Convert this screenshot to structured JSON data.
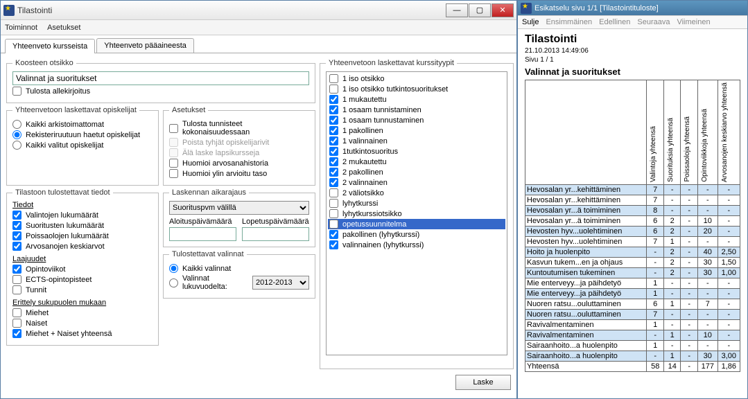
{
  "window": {
    "title": "Tilastointi"
  },
  "menu": {
    "items": [
      "Toiminnot",
      "Asetukset"
    ]
  },
  "tabs": [
    {
      "label": "Yhteenveto kursseista",
      "active": true
    },
    {
      "label": "Yhteenveto pääaineesta",
      "active": false
    }
  ],
  "group_koosteen": {
    "legend": "Koosteen otsikko",
    "value": "Valinnat ja suoritukset",
    "print_sign_label": "Tulosta allekirjoitus",
    "print_sign_checked": false
  },
  "group_laskettavat": {
    "legend": "Yhteenvetoon laskettavat opiskelijat",
    "options": [
      {
        "label": "Kaikki arkistoimattomat",
        "checked": false
      },
      {
        "label": "Rekisteriruutuun haetut opiskelijat",
        "checked": true
      },
      {
        "label": "Kaikki valitut opiskelijat",
        "checked": false
      }
    ]
  },
  "group_tulostettavat": {
    "legend": "Tilastoon tulostettavat tiedot",
    "heading_tiedot": "Tiedot",
    "tiedot": [
      {
        "label": "Valintojen lukumäärät",
        "checked": true
      },
      {
        "label": "Suoritusten lukumäärät",
        "checked": true
      },
      {
        "label": "Poissaolojen lukumäärät",
        "checked": true
      },
      {
        "label": "Arvosanojen keskiarvot",
        "checked": true
      }
    ],
    "heading_laajuudet": "Laajuudet",
    "laajuudet": [
      {
        "label": "Opintoviikot",
        "checked": true
      },
      {
        "label": "ECTS-opintopisteet",
        "checked": false
      },
      {
        "label": "Tunnit",
        "checked": false
      }
    ],
    "heading_erittely": "Erittely sukupuolen mukaan",
    "erittely": [
      {
        "label": "Miehet",
        "checked": false
      },
      {
        "label": "Naiset",
        "checked": false
      },
      {
        "label": "Miehet + Naiset yhteensä",
        "checked": true
      }
    ]
  },
  "group_asetukset": {
    "legend": "Asetukset",
    "items": [
      {
        "label": "Tulosta tunnisteet kokonaisuudessaan",
        "checked": false,
        "disabled": false
      },
      {
        "label": "Poista tyhjät opiskelijarivit",
        "checked": false,
        "disabled": true
      },
      {
        "label": "Älä laske lapsikursseja",
        "checked": false,
        "disabled": true
      },
      {
        "label": "Huomioi arvosanahistoria",
        "checked": false,
        "disabled": false
      },
      {
        "label": "Huomioi ylin arvioitu taso",
        "checked": false,
        "disabled": false
      }
    ]
  },
  "group_aikarajaus": {
    "legend": "Laskennan aikarajaus",
    "select_label": "Suorituspvm välillä",
    "start_label": "Aloituspäivämäärä",
    "end_label": "Lopetuspäivämäärä"
  },
  "group_valinnat": {
    "legend": "Tulostettavat valinnat",
    "options": [
      {
        "label": "Kaikki valinnat",
        "checked": true
      },
      {
        "label": "Valinnat lukuvuodelta:",
        "checked": false
      }
    ],
    "year": "2012-2013"
  },
  "group_kurssityypit": {
    "legend": "Yhteenvetoon laskettavat kurssityypit",
    "items": [
      {
        "label": "1 iso otsikko",
        "checked": false,
        "selected": false
      },
      {
        "label": "1 iso otsikko tutkintosuoritukset",
        "checked": false,
        "selected": false
      },
      {
        "label": "1 mukautettu",
        "checked": true,
        "selected": false
      },
      {
        "label": "1 osaam tunnistaminen",
        "checked": true,
        "selected": false
      },
      {
        "label": "1 osaam tunnustaminen",
        "checked": true,
        "selected": false
      },
      {
        "label": "1 pakollinen",
        "checked": true,
        "selected": false
      },
      {
        "label": "1 valinnainen",
        "checked": true,
        "selected": false
      },
      {
        "label": "1tutkintosuoritus",
        "checked": true,
        "selected": false
      },
      {
        "label": "2 mukautettu",
        "checked": true,
        "selected": false
      },
      {
        "label": "2 pakollinen",
        "checked": true,
        "selected": false
      },
      {
        "label": "2 valinnainen",
        "checked": true,
        "selected": false
      },
      {
        "label": "2 väliotsikko",
        "checked": false,
        "selected": false
      },
      {
        "label": "lyhytkurssi",
        "checked": false,
        "selected": false
      },
      {
        "label": "lyhytkurssiotsikko",
        "checked": false,
        "selected": false
      },
      {
        "label": "opetussuunnitelma",
        "checked": false,
        "selected": true
      },
      {
        "label": "pakollinen (lyhytkurssi)",
        "checked": true,
        "selected": false
      },
      {
        "label": "valinnainen (lyhytkurssi)",
        "checked": true,
        "selected": false
      }
    ]
  },
  "laske_button": "Laske",
  "preview": {
    "title": "Esikatselu sivu 1/1 [Tilastointituloste]",
    "nav": [
      "Sulje",
      "Ensimmäinen",
      "Edellinen",
      "Seuraava",
      "Viimeinen"
    ],
    "report_title": "Tilastointi",
    "timestamp": "21.10.2013 14:49:06",
    "page_line": "Sivu 1 / 1",
    "subtitle": "Valinnat ja suoritukset",
    "columns": [
      "",
      "Valintoja yhteensä",
      "Suorituksia yhteensä",
      "Poissaoloja yhteensä",
      "Opintoviikkoja yhteensä",
      "Arvosanojen keskiarvo yhteensä"
    ],
    "rows": [
      {
        "alt": true,
        "c": [
          "Hevosalan yr...kehittäminen",
          "7",
          "-",
          "-",
          "-",
          "-"
        ]
      },
      {
        "alt": false,
        "c": [
          "Hevosalan yr...kehittäminen",
          "7",
          "-",
          "-",
          "-",
          "-"
        ]
      },
      {
        "alt": true,
        "c": [
          "Hevosalan yr...ä toimiminen",
          "8",
          "-",
          "-",
          "-",
          "-"
        ]
      },
      {
        "alt": false,
        "c": [
          "Hevosalan yr...ä toimiminen",
          "6",
          "2",
          "-",
          "10",
          "-"
        ]
      },
      {
        "alt": true,
        "c": [
          "Hevosten hyv...uolehtiminen",
          "6",
          "2",
          "-",
          "20",
          "-"
        ]
      },
      {
        "alt": false,
        "c": [
          "Hevosten hyv...uolehtiminen",
          "7",
          "1",
          "-",
          "-",
          "-"
        ]
      },
      {
        "alt": true,
        "c": [
          "Hoito ja huolenpito",
          "-",
          "2",
          "-",
          "40",
          "2,50"
        ]
      },
      {
        "alt": false,
        "c": [
          "Kasvun tukem...en ja ohjaus",
          "-",
          "2",
          "-",
          "30",
          "1,50"
        ]
      },
      {
        "alt": true,
        "c": [
          "Kuntoutumisen tukeminen",
          "-",
          "2",
          "-",
          "30",
          "1,00"
        ]
      },
      {
        "alt": false,
        "c": [
          "Mie enterveyy...ja päihdetyö",
          "1",
          "-",
          "-",
          "-",
          "-"
        ]
      },
      {
        "alt": true,
        "c": [
          "Mie enterveyy...ja päihdetyö",
          "1",
          "-",
          "-",
          "-",
          "-"
        ]
      },
      {
        "alt": false,
        "c": [
          "Nuoren ratsu...ouluttaminen",
          "6",
          "1",
          "-",
          "7",
          "-"
        ]
      },
      {
        "alt": true,
        "c": [
          "Nuoren ratsu...ouluttaminen",
          "7",
          "-",
          "-",
          "-",
          "-"
        ]
      },
      {
        "alt": false,
        "c": [
          "Ravivalmentaminen",
          "1",
          "-",
          "-",
          "-",
          "-"
        ]
      },
      {
        "alt": true,
        "c": [
          "Ravivalmentaminen",
          "-",
          "1",
          "-",
          "10",
          "-"
        ]
      },
      {
        "alt": false,
        "c": [
          "Sairaanhoito...a huolenpito",
          "1",
          "-",
          "-",
          "-",
          "-"
        ]
      },
      {
        "alt": true,
        "c": [
          "Sairaanhoito...a huolenpito",
          "-",
          "1",
          "-",
          "30",
          "3,00"
        ]
      }
    ],
    "totals": {
      "label": "Yhteensä",
      "values": [
        "58",
        "14",
        "-",
        "177",
        "1,86"
      ]
    }
  }
}
